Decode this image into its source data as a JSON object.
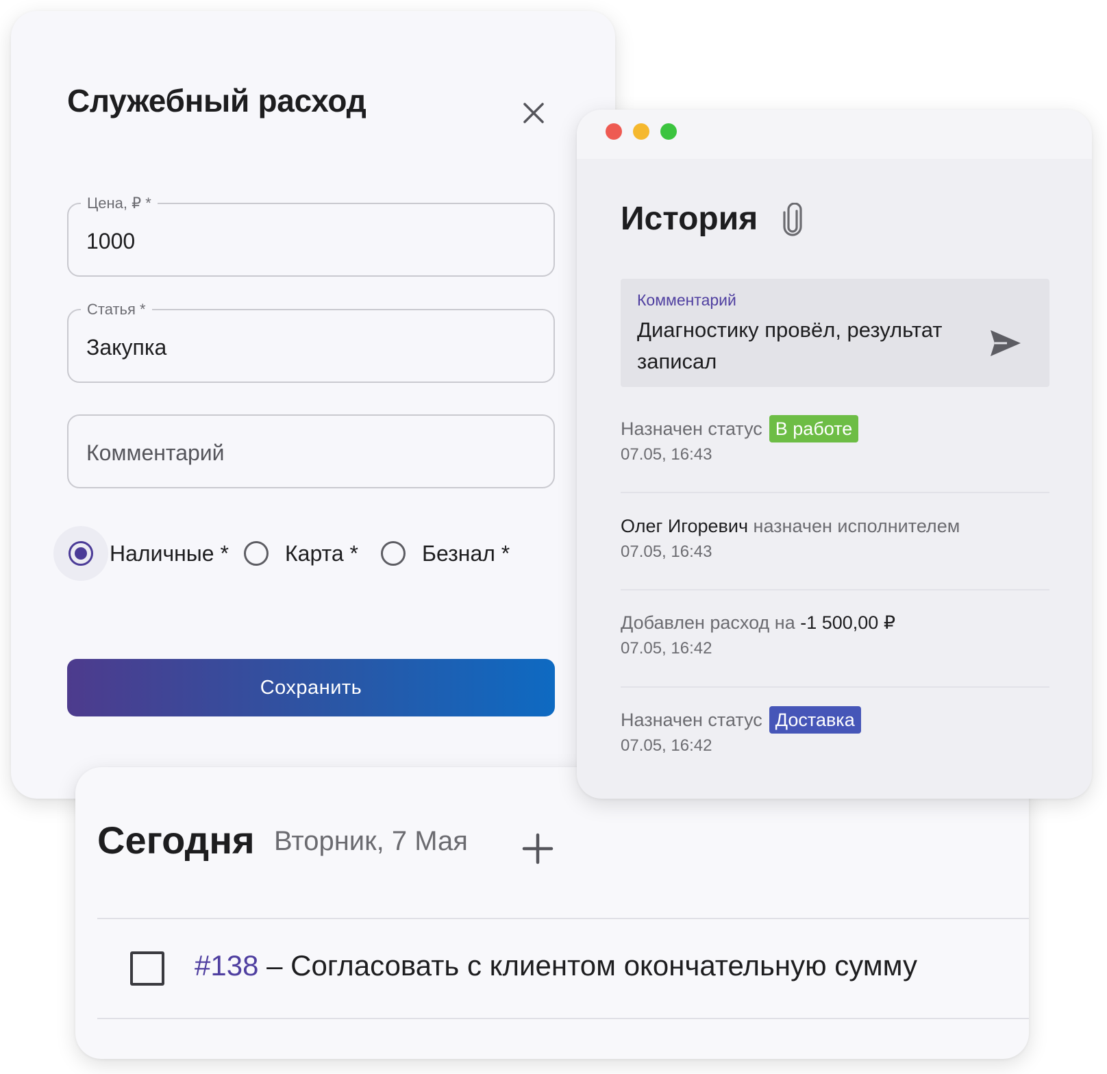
{
  "expense_dialog": {
    "title": "Служебный расход",
    "price": {
      "label": "Цена, ₽ *",
      "value": "1000"
    },
    "article": {
      "label": "Статья *",
      "value": "Закупка"
    },
    "comment": {
      "placeholder": "Комментарий"
    },
    "payment_methods": [
      {
        "label": "Наличные *",
        "selected": true
      },
      {
        "label": "Карта *",
        "selected": false
      },
      {
        "label": "Безнал *",
        "selected": false
      }
    ],
    "save_label": "Сохранить"
  },
  "history": {
    "title": "История",
    "comment_box": {
      "label": "Комментарий",
      "text": "Диагностику провёл, результат записал"
    },
    "events": [
      {
        "prefix": "Назначен статус",
        "badge": "В работе",
        "badge_color": "#6dbd45",
        "time": "07.05, 16:43"
      },
      {
        "strong": "Олег Игоревич",
        "text": "назначен исполнителем",
        "time": "07.05, 16:43"
      },
      {
        "prefix": "Добавлен расход на",
        "amount": "-1 500,00 ₽",
        "time": "07.05, 16:42"
      },
      {
        "prefix": "Назначен статус",
        "badge": "Доставка",
        "badge_color": "#4656b8",
        "time": "07.05, 16:42"
      }
    ]
  },
  "today": {
    "title": "Сегодня",
    "date": "Вторник, 7 Мая",
    "task": {
      "number": "#138",
      "separator": " – ",
      "text": "Согласовать с клиентом окончательную сумму",
      "checked": false
    }
  },
  "colors": {
    "accent": "#4b3b97",
    "button_gradient_start": "#4d3b8d",
    "button_gradient_end": "#0e6ac2",
    "traffic_red": "#ee5a52",
    "traffic_yellow": "#f5b82e",
    "traffic_green": "#3bc43f"
  },
  "icons": [
    "close-icon",
    "paperclip-icon",
    "send-icon",
    "plus-icon"
  ]
}
